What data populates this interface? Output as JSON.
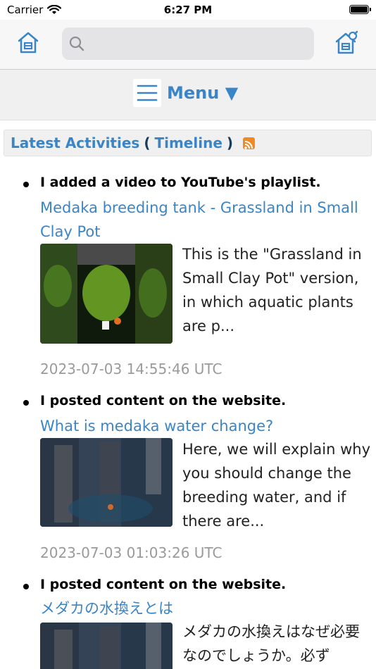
{
  "status_bar": {
    "carrier": "Carrier",
    "time": "6:27 PM"
  },
  "search": {
    "placeholder": "",
    "value": ""
  },
  "menu": {
    "label": "Menu ▼"
  },
  "section": {
    "title": "Latest Activities",
    "paren_open": "(",
    "timeline_link": "Timeline",
    "paren_close": ")"
  },
  "activities": [
    {
      "heading": "I added a video to YouTube's playlist.",
      "link": "Medaka breeding tank - Grassland in Small Clay Pot",
      "excerpt": "This is the \"Grassland in Small Clay Pot\" version, in which aquatic plants are p...",
      "date": "2023-07-03 14:55:46 UTC"
    },
    {
      "heading": "I posted content on the website.",
      "link": "What is medaka water change?",
      "excerpt": "Here, we will explain why you should change the breeding water, and if there are...",
      "date": "2023-07-03 01:03:26 UTC"
    },
    {
      "heading": "I posted content on the website.",
      "link": "メダカの水換えとは",
      "excerpt": "メダカの水換えはなぜ必要なのでしょうか。必ず"
    }
  ],
  "colors": {
    "link": "#3a85c7",
    "date": "#9a9a9a",
    "rss": "#f08a24"
  }
}
